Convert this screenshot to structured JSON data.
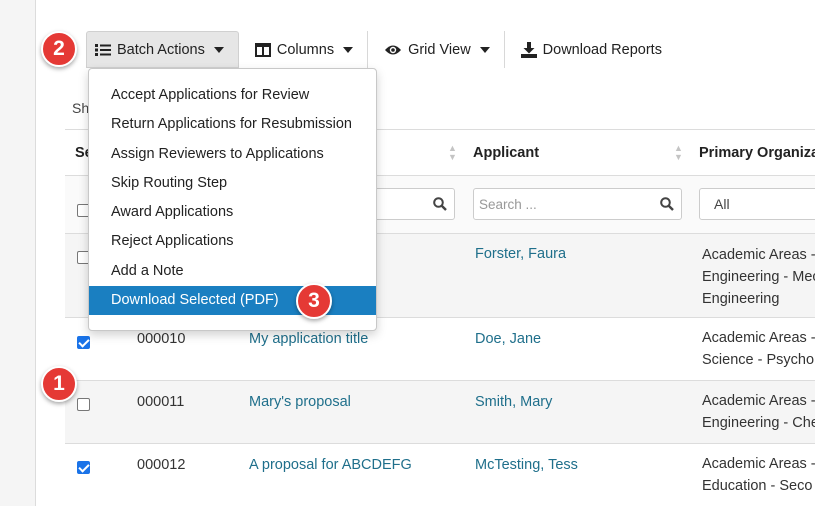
{
  "toolbar": {
    "batch_actions": "Batch Actions",
    "columns": "Columns",
    "grid_view": "Grid View",
    "download_reports": "Download Reports"
  },
  "show_label": "Sh",
  "table": {
    "headers": {
      "select": "Se",
      "applicant": "Applicant",
      "primary_org": "Primary Organiza"
    },
    "filters": {
      "title_placeholder": "",
      "applicant_placeholder": "Search ...",
      "org_select_value": "All"
    },
    "rows": [
      {
        "checked": false,
        "id": "",
        "title": "",
        "applicant": "Forster, Faura",
        "org_lines": [
          "Academic Areas -",
          "Engineering - Mec",
          "Engineering"
        ]
      },
      {
        "checked": true,
        "id": "000010",
        "title": "My application title",
        "applicant": "Doe, Jane",
        "org_lines": [
          "Academic Areas -",
          "Science - Psycho"
        ]
      },
      {
        "checked": false,
        "id": "000011",
        "title": "Mary's proposal",
        "applicant": "Smith, Mary",
        "org_lines": [
          "Academic Areas -",
          "Engineering - Che"
        ]
      },
      {
        "checked": true,
        "id": "000012",
        "title": "A proposal for ABCDEFG",
        "applicant": "McTesting, Tess",
        "org_lines": [
          "Academic Areas -",
          "Education - Seco"
        ]
      }
    ]
  },
  "dropdown": {
    "items": [
      "Accept Applications for Review",
      "Return Applications for Resubmission",
      "Assign Reviewers to Applications",
      "Skip Routing Step",
      "Award Applications",
      "Reject Applications",
      "Add a Note",
      "Download Selected (PDF)"
    ],
    "selected_index": 7
  },
  "callouts": [
    "1",
    "2",
    "3"
  ],
  "colors": {
    "accent": "#1a7fc1",
    "link": "#1f6f8b",
    "callout": "#e53935",
    "checkbox": "#1a73e8"
  },
  "icons": {
    "batch_actions": "list-icon",
    "columns": "columns-icon",
    "grid_view": "eye-icon",
    "download_reports": "download-icon",
    "search": "magnifier-icon"
  }
}
